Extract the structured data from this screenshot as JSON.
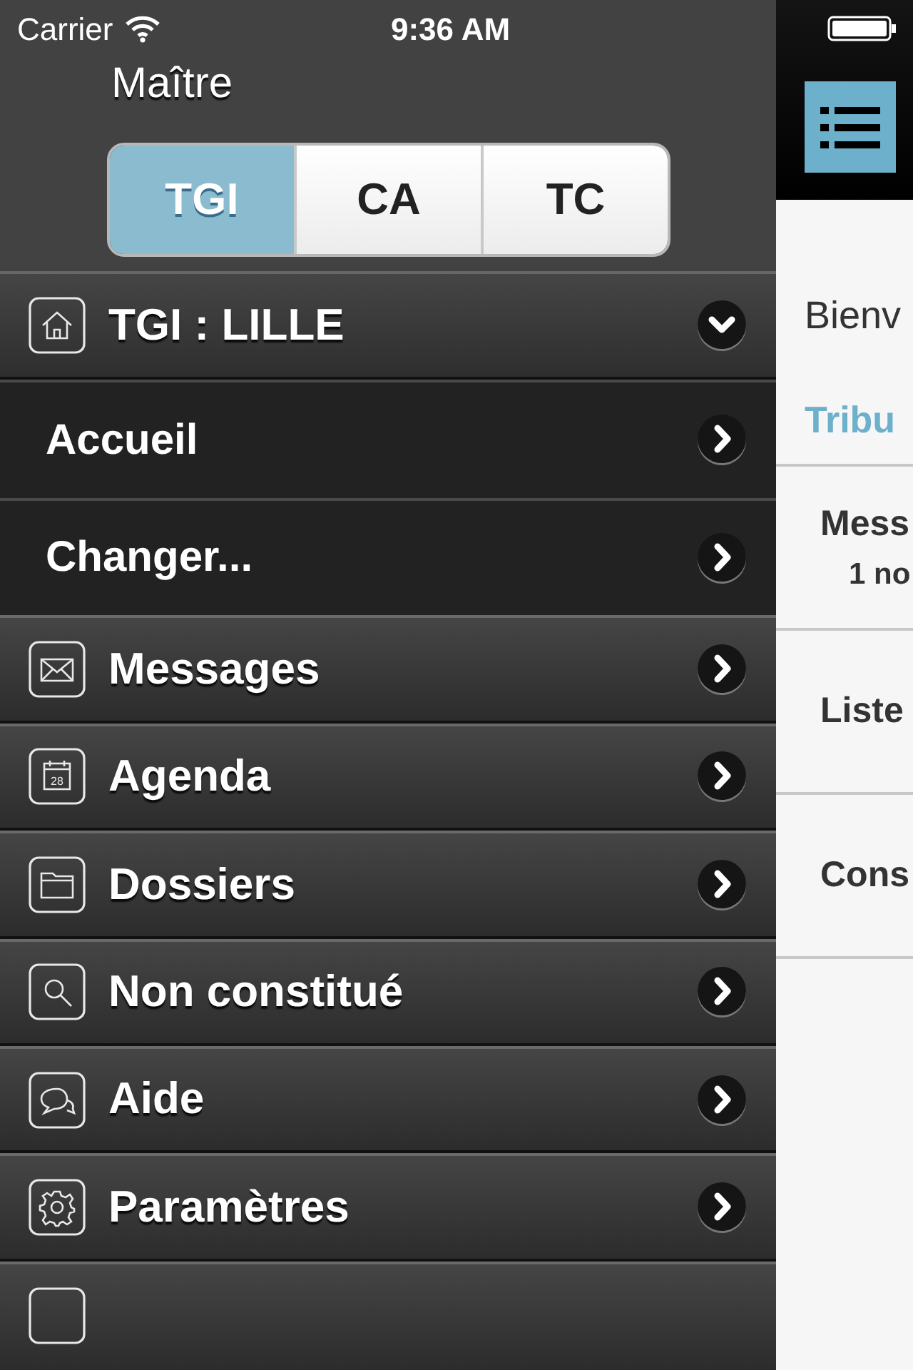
{
  "status_bar": {
    "carrier": "Carrier",
    "time": "9:36 AM"
  },
  "sidebar": {
    "title": "Maître",
    "segments": [
      {
        "label": "TGI",
        "selected": true
      },
      {
        "label": "CA",
        "selected": false
      },
      {
        "label": "TC",
        "selected": false
      }
    ],
    "items": [
      {
        "kind": "section",
        "label": "TGI : LILLE",
        "expanded": true
      },
      {
        "kind": "sub",
        "label": "Accueil"
      },
      {
        "kind": "sub",
        "label": "Changer..."
      },
      {
        "kind": "nav",
        "label": "Messages"
      },
      {
        "kind": "nav",
        "label": "Agenda",
        "icon_text": "28"
      },
      {
        "kind": "nav",
        "label": "Dossiers"
      },
      {
        "kind": "nav",
        "label": "Non constitué"
      },
      {
        "kind": "nav",
        "label": "Aide"
      },
      {
        "kind": "nav",
        "label": "Paramètres"
      },
      {
        "kind": "partial"
      }
    ]
  },
  "main": {
    "welcome": "Bienv",
    "section_title": "Tribu",
    "cells": [
      {
        "title": "Mess",
        "subtitle": "1 no"
      },
      {
        "title": "Liste"
      },
      {
        "title": "Cons"
      }
    ]
  }
}
